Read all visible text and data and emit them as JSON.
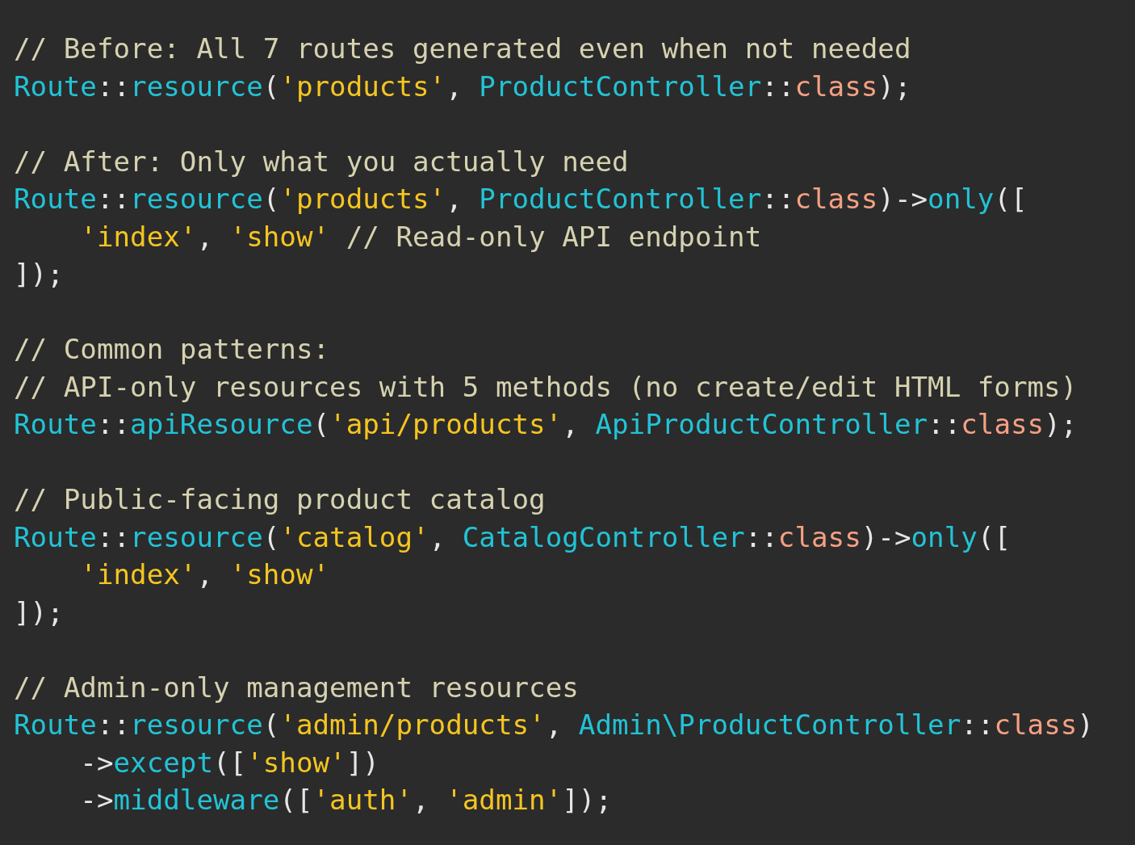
{
  "editor": {
    "lines": [
      {
        "kind": "code",
        "indent": false,
        "tokens": [
          {
            "kind": "comment",
            "text": "// Before: All 7 routes generated even when not needed"
          }
        ]
      },
      {
        "kind": "code",
        "indent": false,
        "tokens": [
          {
            "kind": "class",
            "text": "Route"
          },
          {
            "kind": "punct",
            "text": "::"
          },
          {
            "kind": "method",
            "text": "resource"
          },
          {
            "kind": "punct",
            "text": "("
          },
          {
            "kind": "string",
            "text": "'products'"
          },
          {
            "kind": "punct",
            "text": ", "
          },
          {
            "kind": "class",
            "text": "ProductController"
          },
          {
            "kind": "punct",
            "text": "::"
          },
          {
            "kind": "keyword",
            "text": "class"
          },
          {
            "kind": "punct",
            "text": ");"
          }
        ]
      },
      {
        "kind": "blank"
      },
      {
        "kind": "code",
        "indent": false,
        "tokens": [
          {
            "kind": "comment",
            "text": "// After: Only what you actually need"
          }
        ]
      },
      {
        "kind": "code",
        "indent": false,
        "tokens": [
          {
            "kind": "class",
            "text": "Route"
          },
          {
            "kind": "punct",
            "text": "::"
          },
          {
            "kind": "method",
            "text": "resource"
          },
          {
            "kind": "punct",
            "text": "("
          },
          {
            "kind": "string",
            "text": "'products'"
          },
          {
            "kind": "punct",
            "text": ", "
          },
          {
            "kind": "class",
            "text": "ProductController"
          },
          {
            "kind": "punct",
            "text": "::"
          },
          {
            "kind": "keyword",
            "text": "class"
          },
          {
            "kind": "punct",
            "text": ")->"
          },
          {
            "kind": "method",
            "text": "only"
          },
          {
            "kind": "punct",
            "text": "(["
          }
        ]
      },
      {
        "kind": "code",
        "indent": true,
        "tokens": [
          {
            "kind": "string",
            "text": "'index'"
          },
          {
            "kind": "punct",
            "text": ", "
          },
          {
            "kind": "string",
            "text": "'show'"
          },
          {
            "kind": "comment",
            "text": " // Read-only API endpoint"
          }
        ]
      },
      {
        "kind": "code",
        "indent": false,
        "tokens": [
          {
            "kind": "punct",
            "text": "]);"
          }
        ]
      },
      {
        "kind": "blank"
      },
      {
        "kind": "code",
        "indent": false,
        "tokens": [
          {
            "kind": "comment",
            "text": "// Common patterns:"
          }
        ]
      },
      {
        "kind": "code",
        "indent": false,
        "tokens": [
          {
            "kind": "comment",
            "text": "// API-only resources with 5 methods (no create/edit HTML forms)"
          }
        ]
      },
      {
        "kind": "code",
        "indent": false,
        "tokens": [
          {
            "kind": "class",
            "text": "Route"
          },
          {
            "kind": "punct",
            "text": "::"
          },
          {
            "kind": "method",
            "text": "apiResource"
          },
          {
            "kind": "punct",
            "text": "("
          },
          {
            "kind": "string",
            "text": "'api/products'"
          },
          {
            "kind": "punct",
            "text": ", "
          },
          {
            "kind": "class",
            "text": "ApiProductController"
          },
          {
            "kind": "punct",
            "text": "::"
          },
          {
            "kind": "keyword",
            "text": "class"
          },
          {
            "kind": "punct",
            "text": ");"
          }
        ]
      },
      {
        "kind": "blank"
      },
      {
        "kind": "code",
        "indent": false,
        "tokens": [
          {
            "kind": "comment",
            "text": "// Public-facing product catalog"
          }
        ]
      },
      {
        "kind": "code",
        "indent": false,
        "tokens": [
          {
            "kind": "class",
            "text": "Route"
          },
          {
            "kind": "punct",
            "text": "::"
          },
          {
            "kind": "method",
            "text": "resource"
          },
          {
            "kind": "punct",
            "text": "("
          },
          {
            "kind": "string",
            "text": "'catalog'"
          },
          {
            "kind": "punct",
            "text": ", "
          },
          {
            "kind": "class",
            "text": "CatalogController"
          },
          {
            "kind": "punct",
            "text": "::"
          },
          {
            "kind": "keyword",
            "text": "class"
          },
          {
            "kind": "punct",
            "text": ")->"
          },
          {
            "kind": "method",
            "text": "only"
          },
          {
            "kind": "punct",
            "text": "(["
          }
        ]
      },
      {
        "kind": "code",
        "indent": true,
        "tokens": [
          {
            "kind": "string",
            "text": "'index'"
          },
          {
            "kind": "punct",
            "text": ", "
          },
          {
            "kind": "string",
            "text": "'show'"
          }
        ]
      },
      {
        "kind": "code",
        "indent": false,
        "tokens": [
          {
            "kind": "punct",
            "text": "]);"
          }
        ]
      },
      {
        "kind": "blank"
      },
      {
        "kind": "code",
        "indent": false,
        "tokens": [
          {
            "kind": "comment",
            "text": "// Admin-only management resources"
          }
        ]
      },
      {
        "kind": "code",
        "indent": false,
        "tokens": [
          {
            "kind": "class",
            "text": "Route"
          },
          {
            "kind": "punct",
            "text": "::"
          },
          {
            "kind": "method",
            "text": "resource"
          },
          {
            "kind": "punct",
            "text": "("
          },
          {
            "kind": "string",
            "text": "'admin/products'"
          },
          {
            "kind": "punct",
            "text": ", "
          },
          {
            "kind": "class",
            "text": "Admin\\ProductController"
          },
          {
            "kind": "punct",
            "text": "::"
          },
          {
            "kind": "keyword",
            "text": "class"
          },
          {
            "kind": "punct",
            "text": ")"
          }
        ]
      },
      {
        "kind": "code",
        "indent": true,
        "tokens": [
          {
            "kind": "punct",
            "text": "->"
          },
          {
            "kind": "method",
            "text": "except"
          },
          {
            "kind": "punct",
            "text": "(["
          },
          {
            "kind": "string",
            "text": "'show'"
          },
          {
            "kind": "punct",
            "text": "])"
          }
        ]
      },
      {
        "kind": "code",
        "indent": true,
        "tokens": [
          {
            "kind": "punct",
            "text": "->"
          },
          {
            "kind": "method",
            "text": "middleware"
          },
          {
            "kind": "punct",
            "text": "(["
          },
          {
            "kind": "string",
            "text": "'auth'"
          },
          {
            "kind": "punct",
            "text": ", "
          },
          {
            "kind": "string",
            "text": "'admin'"
          },
          {
            "kind": "punct",
            "text": "]);"
          }
        ]
      }
    ]
  }
}
